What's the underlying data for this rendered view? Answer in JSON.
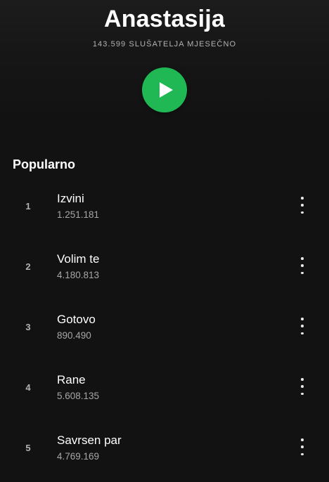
{
  "artist": {
    "name": "Anastasija",
    "monthly_listeners": "143.599 SLUŠATELJA MJESEČNO"
  },
  "play_icon": "play-icon",
  "accent_color": "#1fb855",
  "popular": {
    "heading": "Popularno",
    "tracks": [
      {
        "index": "1",
        "title": "Izvini",
        "plays": "1.251.181"
      },
      {
        "index": "2",
        "title": "Volim te",
        "plays": "4.180.813"
      },
      {
        "index": "3",
        "title": "Gotovo",
        "plays": "890.490"
      },
      {
        "index": "4",
        "title": "Rane",
        "plays": "5.608.135"
      },
      {
        "index": "5",
        "title": "Savrsen par",
        "plays": "4.769.169"
      }
    ]
  },
  "more_icon": "more-vertical-icon"
}
